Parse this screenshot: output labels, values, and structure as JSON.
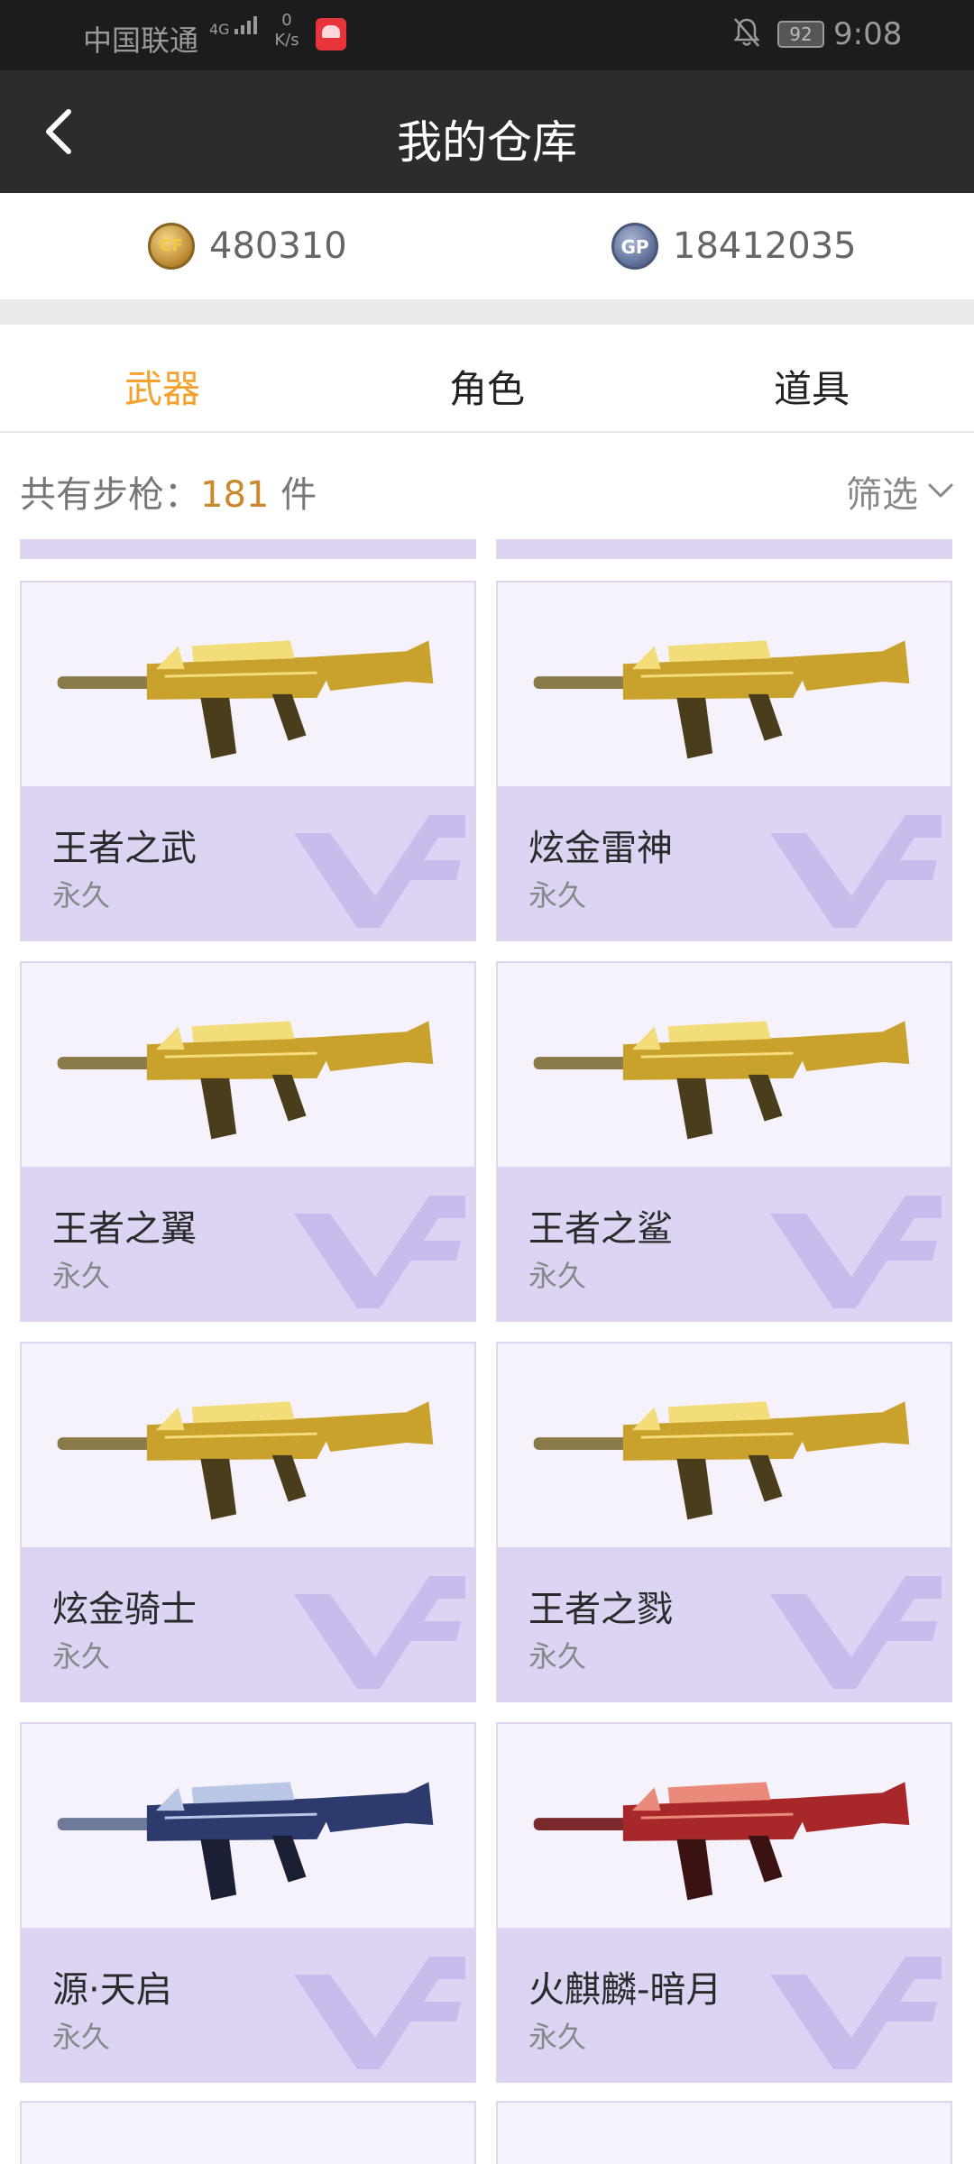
{
  "status_bar": {
    "carrier": "中国联通",
    "network": "4G",
    "speed_value": "0",
    "speed_unit": "K/s",
    "battery": "92",
    "time": "9:08"
  },
  "header": {
    "title": "我的仓库"
  },
  "currency": {
    "cf_points": "480310",
    "gp_points": "18412035"
  },
  "tabs": [
    {
      "label": "武器",
      "active": true
    },
    {
      "label": "角色",
      "active": false
    },
    {
      "label": "道具",
      "active": false
    }
  ],
  "count": {
    "prefix": "共有步枪：",
    "number": "181",
    "suffix": " 件"
  },
  "filter": {
    "label": "筛选"
  },
  "colors": {
    "accent": "#f4a22f",
    "count_number": "#c9892c",
    "card_info_bg": "#ddd4f4",
    "card_bg": "#f5f2fc",
    "header_bg": "#2c2c2e"
  },
  "weapons": [
    {
      "name": "王者之武",
      "duration": "永久",
      "scheme": "gold"
    },
    {
      "name": "炫金雷神",
      "duration": "永久",
      "scheme": "gold"
    },
    {
      "name": "王者之翼",
      "duration": "永久",
      "scheme": "gold"
    },
    {
      "name": "王者之鲨",
      "duration": "永久",
      "scheme": "gold"
    },
    {
      "name": "炫金骑士",
      "duration": "永久",
      "scheme": "gold"
    },
    {
      "name": "王者之戮",
      "duration": "永久",
      "scheme": "gold"
    },
    {
      "name": "源·天启",
      "duration": "永久",
      "scheme": "blue"
    },
    {
      "name": "火麒麟-暗月",
      "duration": "永久",
      "scheme": "red"
    }
  ]
}
